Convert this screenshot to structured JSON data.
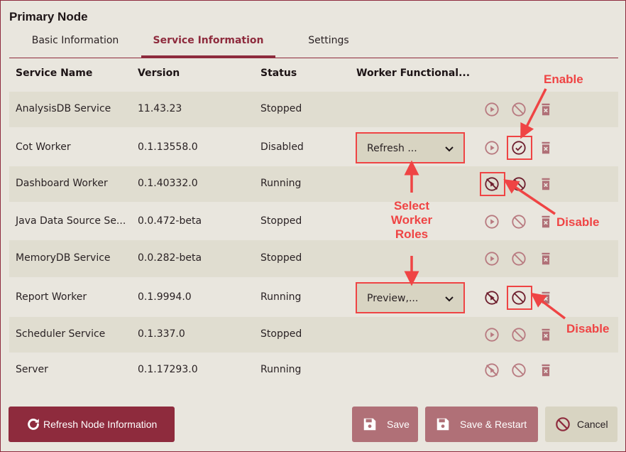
{
  "header": {
    "title": "Primary Node"
  },
  "tabs": [
    {
      "label": "Basic Information",
      "active": false
    },
    {
      "label": "Service Information",
      "active": true
    },
    {
      "label": "Settings",
      "active": false
    }
  ],
  "table": {
    "columns": [
      "Service Name",
      "Version",
      "Status",
      "Worker Functional..."
    ],
    "rows": [
      {
        "name": "AnalysisDB Service",
        "version": "11.43.23",
        "status": "Stopped",
        "worker": null,
        "actions": [
          "play",
          "disable",
          "delete"
        ]
      },
      {
        "name": "Cot Worker",
        "version": "0.1.13558.0",
        "status": "Disabled",
        "worker": "Refresh ...",
        "actions": [
          "play",
          "enable",
          "delete"
        ]
      },
      {
        "name": "Dashboard Worker",
        "version": "0.1.40332.0",
        "status": "Running",
        "worker": null,
        "actions": [
          "stop",
          "disable",
          "delete"
        ]
      },
      {
        "name": "Java Data Source Se...",
        "version": "0.0.472-beta",
        "status": "Stopped",
        "worker": null,
        "actions": [
          "play",
          "disable",
          "delete"
        ]
      },
      {
        "name": "MemoryDB Service",
        "version": "0.0.282-beta",
        "status": "Stopped",
        "worker": null,
        "actions": [
          "play",
          "disable",
          "delete"
        ]
      },
      {
        "name": "Report Worker",
        "version": "0.1.9994.0",
        "status": "Running",
        "worker": "Preview,...",
        "actions": [
          "stop",
          "disable",
          "delete"
        ]
      },
      {
        "name": "Scheduler Service",
        "version": "0.1.337.0",
        "status": "Stopped",
        "worker": null,
        "actions": [
          "play",
          "disable",
          "delete"
        ]
      },
      {
        "name": "Server",
        "version": "0.1.17293.0",
        "status": "Running",
        "worker": null,
        "actions": [
          "stop",
          "disable",
          "delete"
        ]
      }
    ]
  },
  "annotations": {
    "enable": "Enable",
    "disable_1": "Disable",
    "disable_2": "Disable",
    "select_roles": "Select\nWorker\nRoles"
  },
  "footer": {
    "refresh_label": "Refresh Node Information",
    "save_label": "Save",
    "save_restart_label": "Save & Restart",
    "cancel_label": "Cancel"
  },
  "colors": {
    "brand": "#8e2b3d",
    "brand_muted": "#b07077",
    "icon_muted": "#b87a80",
    "icon_active": "#6e1f2e",
    "annotation": "#ef4444",
    "background": "#e9e6de",
    "row_alt": "#e0ddd0",
    "select_bg": "#d8d4c2"
  }
}
